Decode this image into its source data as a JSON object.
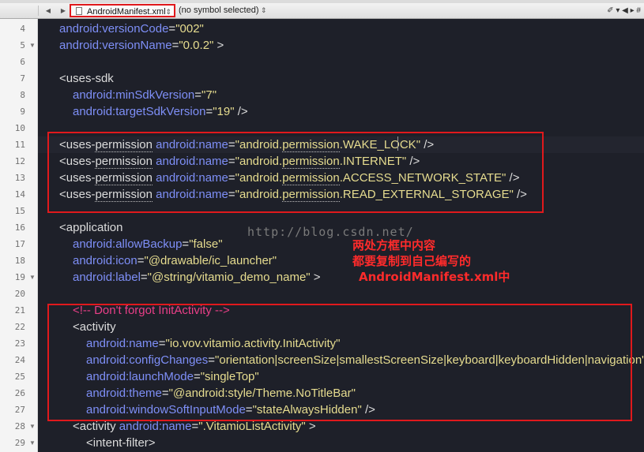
{
  "jump_bar": {
    "file_name": "AndroidManifest.xml",
    "symbol_selector": "(no symbol selected)",
    "back_glyph": "◀",
    "forward_glyph": "▶",
    "right_tools": "✐ ▾ ◀ ▸ #"
  },
  "watermark": "http://blog.csdn.net/",
  "annotation": {
    "line1": "两处方框中内容",
    "line2": "都要复制到自己编写的",
    "line3": "AndroidManifest.xml中"
  },
  "editor": {
    "line_numbers": [
      "4",
      "5",
      "6",
      "7",
      "8",
      "9",
      "10",
      "11",
      "12",
      "13",
      "14",
      "15",
      "16",
      "17",
      "18",
      "19",
      "20",
      "21",
      "22",
      "23",
      "24",
      "25",
      "26",
      "27",
      "28",
      "29"
    ],
    "lines": {
      "l4": {
        "attr": "android:versionCode",
        "eq": "=",
        "val": "\"002\""
      },
      "l5": {
        "attr": "android:versionName",
        "eq": "=",
        "val": "\"0.0.2\"",
        "close": " >"
      },
      "l7": {
        "tag": "<uses-sdk"
      },
      "l8": {
        "attr": "android:minSdkVersion",
        "eq": "=",
        "val": "\"7\""
      },
      "l9": {
        "attr": "android:targetSdkVersion",
        "eq": "=",
        "val": "\"19\"",
        "close": " />"
      },
      "l11": {
        "tag_open": "<uses-",
        "tag_perm": "permission",
        "attr": " android:name",
        "eq": "=",
        "val_a": "\"android.",
        "val_perm": "permission",
        "val_b": ".WAKE_LOCK\"",
        "close": " />"
      },
      "l12": {
        "tag_open": "<uses-",
        "tag_perm": "permission",
        "attr": " android:name",
        "eq": "=",
        "val_a": "\"android.",
        "val_perm": "permission",
        "val_b": ".INTERNET\"",
        "close": " />"
      },
      "l13": {
        "tag_open": "<uses-",
        "tag_perm": "permission",
        "attr": " android:name",
        "eq": "=",
        "val_a": "\"android.",
        "val_perm": "permission",
        "val_b": ".ACCESS_NETWORK_STATE\"",
        "close": " />"
      },
      "l14": {
        "tag_open": "<uses-",
        "tag_perm": "permission",
        "attr": " android:name",
        "eq": "=",
        "val_a": "\"android.",
        "val_perm": "permission",
        "val_b": ".READ_EXTERNAL_STORAGE\"",
        "close": " />"
      },
      "l16": {
        "tag": "<application"
      },
      "l17": {
        "attr": "android:allowBackup",
        "eq": "=",
        "val": "\"false\""
      },
      "l18": {
        "attr": "android:icon",
        "eq": "=",
        "val": "\"@drawable/ic_launcher\""
      },
      "l19": {
        "attr": "android:label",
        "eq": "=",
        "val": "\"@string/vitamio_demo_name\"",
        "close": " >"
      },
      "l21": {
        "comment": "<!-- Don't forgot InitActivity -->"
      },
      "l22": {
        "tag": "<activity"
      },
      "l23": {
        "attr": "android:name",
        "eq": "=",
        "val": "\"io.vov.vitamio.activity.InitActivity\""
      },
      "l24": {
        "attr": "android:configChanges",
        "eq": "=",
        "val": "\"orientation|screenSize|smallestScreenSize|keyboard|keyboardHidden|navigation\""
      },
      "l25": {
        "attr": "android:launchMode",
        "eq": "=",
        "val": "\"singleTop\""
      },
      "l26": {
        "attr": "android:theme",
        "eq": "=",
        "val": "\"@android:style/Theme.NoTitleBar\""
      },
      "l27": {
        "attr": "android:windowSoftInputMode",
        "eq": "=",
        "val": "\"stateAlwaysHidden\"",
        "close": " />"
      },
      "l28": {
        "tag": "<activity",
        "attr": " android:name",
        "eq": "=",
        "val": "\".VitamioListActivity\"",
        "close": " >"
      },
      "l29": {
        "tag": "<intent-filter>"
      }
    }
  },
  "colors": {
    "background": "#1e2029",
    "attribute": "#7e8ff7",
    "string": "#e6dc8f",
    "comment": "#ea3f88",
    "highlight_box": "#e0191c",
    "annotation": "#ff2b2b"
  }
}
